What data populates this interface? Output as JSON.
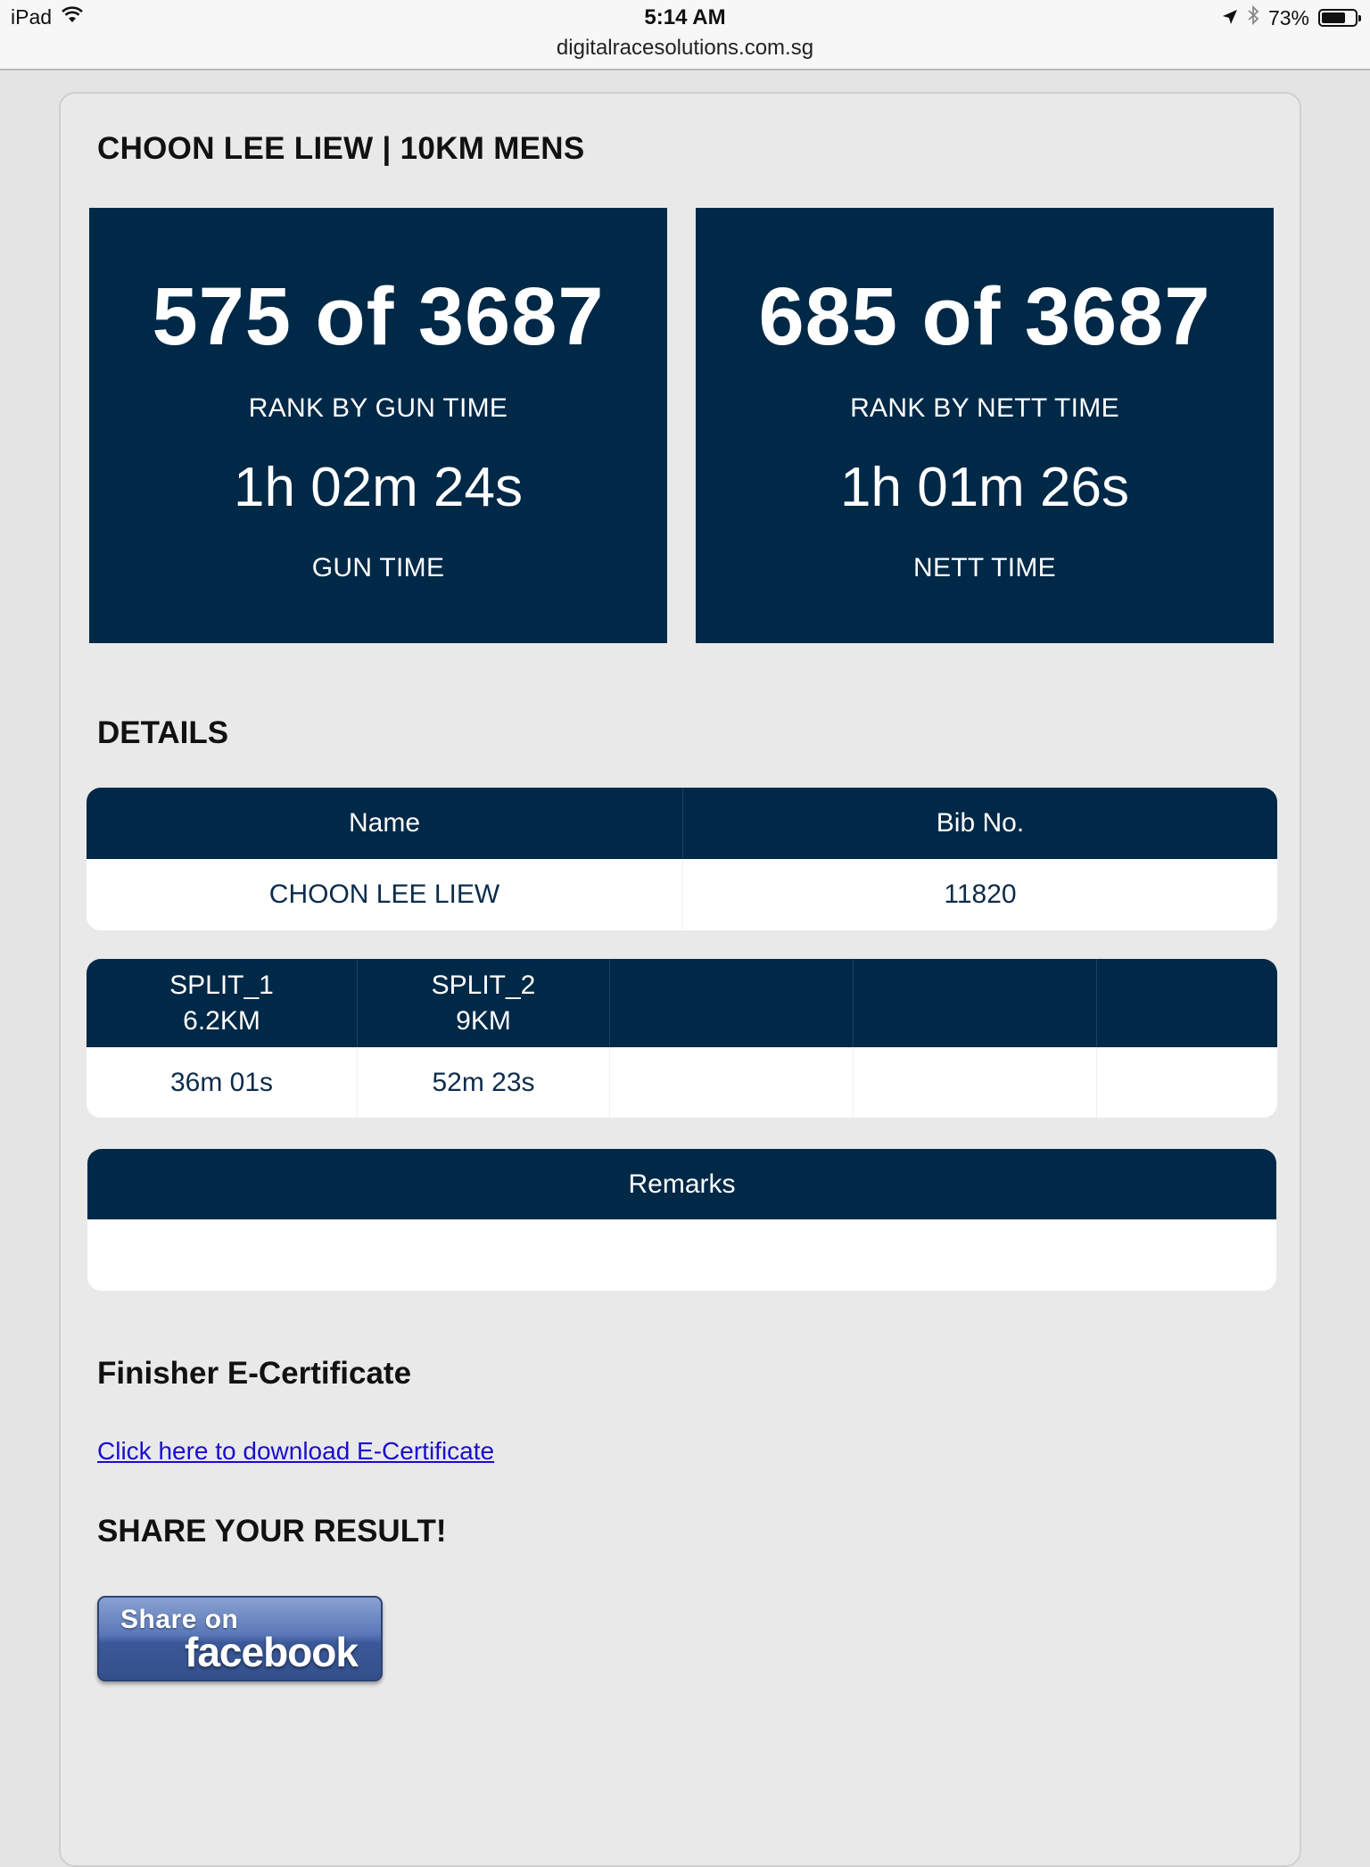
{
  "status_bar": {
    "device": "iPad",
    "time": "5:14 AM",
    "url": "digitalracesolutions.com.sg",
    "battery": "73%",
    "battery_level": 0.73
  },
  "page": {
    "title": "CHOON LEE LIEW | 10KM MENS",
    "rank_gun": {
      "rank": "575 of 3687",
      "label": "RANK BY GUN TIME",
      "time": "1h 02m 24s",
      "time_label": "GUN TIME"
    },
    "rank_nett": {
      "rank": "685 of 3687",
      "label": "RANK BY NETT TIME",
      "time": "1h 01m 26s",
      "time_label": "NETT TIME"
    },
    "details_heading": "DETAILS",
    "details_table": {
      "headers": [
        "Name",
        "Bib No."
      ],
      "values": [
        "CHOON LEE LIEW",
        "11820"
      ]
    },
    "splits_table": {
      "headers": [
        {
          "line1": "SPLIT_1",
          "line2": "6.2KM"
        },
        {
          "line1": "SPLIT_2",
          "line2": "9KM"
        }
      ],
      "values": [
        "36m 01s",
        "52m 23s"
      ]
    },
    "remarks_table": {
      "header": "Remarks",
      "value": ""
    },
    "certificate_heading": "Finisher E-Certificate",
    "certificate_link": "Click here to download E-Certificate",
    "share_heading": "SHARE YOUR RESULT!",
    "share_button": {
      "line1": "Share on",
      "line2": "facebook"
    }
  },
  "colors": {
    "navy": "#002847",
    "page_bg": "#e4e4e4",
    "link": "#1a0dcc",
    "facebook": "#3b5998"
  },
  "icons": [
    "wifi-icon",
    "location-arrow-icon",
    "bluetooth-icon",
    "battery-icon"
  ]
}
